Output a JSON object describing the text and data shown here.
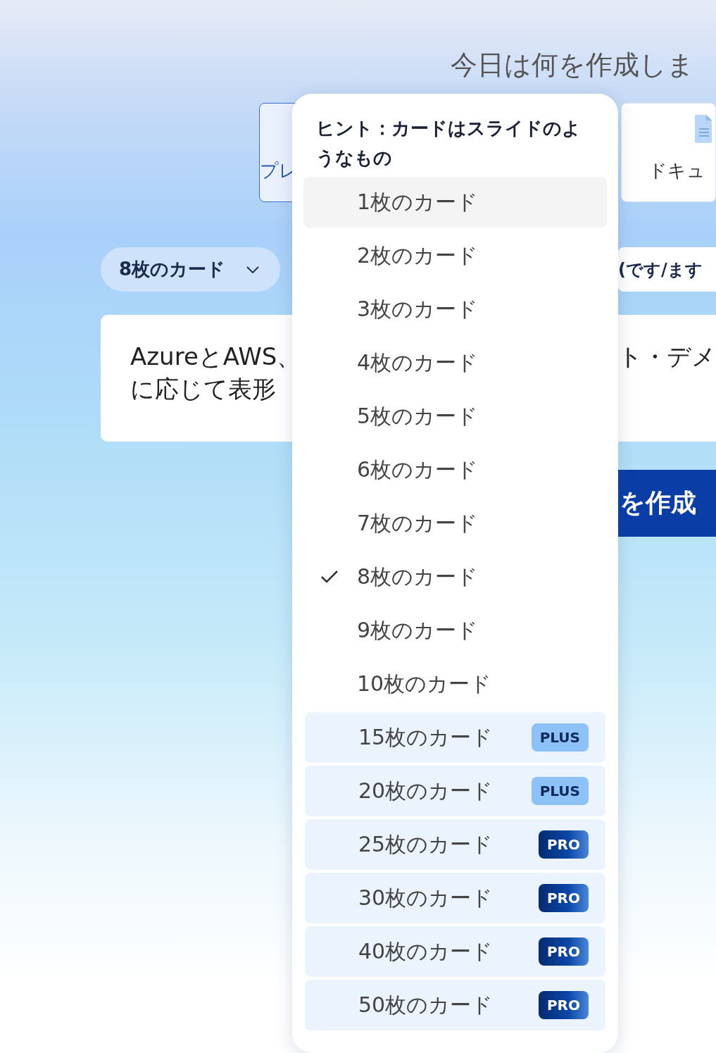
{
  "subtitle": "今日は何を作成しま",
  "format_tabs": [
    {
      "label": "プレ",
      "selected": true
    },
    {
      "label": "ドキュ",
      "selected": false
    }
  ],
  "card_count_select": {
    "value": "8枚のカード"
  },
  "language_select": {
    "value": "(です/ます"
  },
  "prompt": {
    "left_lines": [
      "AzureとAWS、",
      "に応じて表形"
    ],
    "right_lines": [
      "ト・デメ"
    ]
  },
  "generate_button": {
    "label": "を作成"
  },
  "dropdown": {
    "hint": "ヒント：カードはスライドのようなもの",
    "items": [
      {
        "label": "1枚のカード",
        "selected": false,
        "hovered": true
      },
      {
        "label": "2枚のカード",
        "selected": false,
        "hovered": false
      },
      {
        "label": "3枚のカード",
        "selected": false,
        "hovered": false
      },
      {
        "label": "4枚のカード",
        "selected": false,
        "hovered": false
      },
      {
        "label": "5枚のカード",
        "selected": false,
        "hovered": false
      },
      {
        "label": "6枚のカード",
        "selected": false,
        "hovered": false
      },
      {
        "label": "7枚のカード",
        "selected": false,
        "hovered": false
      },
      {
        "label": "8枚のカード",
        "selected": true,
        "hovered": false
      },
      {
        "label": "9枚のカード",
        "selected": false,
        "hovered": false
      },
      {
        "label": "10枚のカード",
        "selected": false,
        "hovered": false
      },
      {
        "label": "15枚のカード",
        "selected": false,
        "hovered": false,
        "badge": {
          "text": "PLUS",
          "kind": "plus"
        }
      },
      {
        "label": "20枚のカード",
        "selected": false,
        "hovered": false,
        "badge": {
          "text": "PLUS",
          "kind": "plus"
        }
      },
      {
        "label": "25枚のカード",
        "selected": false,
        "hovered": false,
        "badge": {
          "text": "PRO",
          "kind": "pro"
        }
      },
      {
        "label": "30枚のカード",
        "selected": false,
        "hovered": false,
        "badge": {
          "text": "PRO",
          "kind": "pro"
        }
      },
      {
        "label": "40枚のカード",
        "selected": false,
        "hovered": false,
        "badge": {
          "text": "PRO",
          "kind": "pro"
        }
      },
      {
        "label": "50枚のカード",
        "selected": false,
        "hovered": false,
        "badge": {
          "text": "PRO",
          "kind": "pro"
        }
      }
    ]
  }
}
